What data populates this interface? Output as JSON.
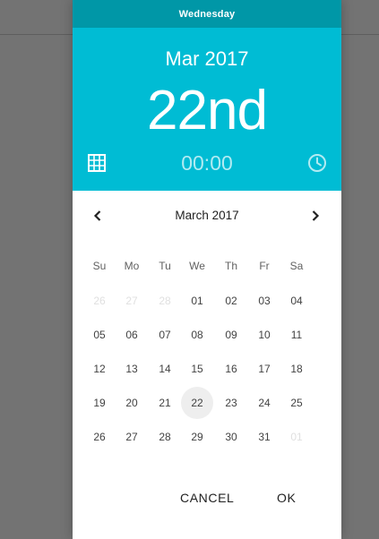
{
  "header": {
    "day_of_week": "Wednesday",
    "month_year": "Mar 2017",
    "day_label": "22nd",
    "time": "00:00"
  },
  "calendar": {
    "title": "March 2017",
    "weekdays": [
      "Su",
      "Mo",
      "Tu",
      "We",
      "Th",
      "Fr",
      "Sa"
    ],
    "weeks": [
      [
        "26",
        "27",
        "28",
        "01",
        "02",
        "03",
        "04"
      ],
      [
        "05",
        "06",
        "07",
        "08",
        "09",
        "10",
        "11"
      ],
      [
        "12",
        "13",
        "14",
        "15",
        "16",
        "17",
        "18"
      ],
      [
        "19",
        "20",
        "21",
        "22",
        "23",
        "24",
        "25"
      ],
      [
        "26",
        "27",
        "28",
        "29",
        "30",
        "31",
        "01"
      ]
    ],
    "selected_day": "22"
  },
  "actions": {
    "cancel_label": "CANCEL",
    "ok_label": "OK"
  },
  "icons": {
    "calendar": "calendar-grid-icon",
    "clock": "clock-icon",
    "prev": "chevron-left-icon",
    "next": "chevron-right-icon"
  },
  "colors": {
    "header_bg": "#00bcd4",
    "day_of_week_bg": "#0097a7",
    "time_text": "#b2ebf2",
    "selected_day_bg": "#eeeeee"
  }
}
